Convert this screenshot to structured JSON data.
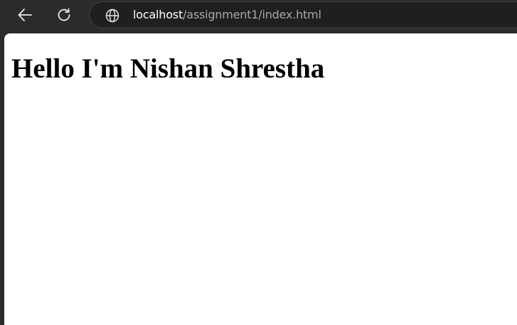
{
  "address_bar": {
    "url_host": "localhost",
    "url_path": "/assignment1/index.html"
  },
  "toolbar": {
    "back_icon": "arrow-left-icon",
    "reload_icon": "reload-icon",
    "site_info_icon": "globe-icon"
  },
  "page": {
    "heading": "Hello I'm Nishan Shrestha"
  },
  "colors": {
    "chrome_background": "#2b2b2b",
    "address_bar_background": "#1f1f1f",
    "url_host": "#ffffff",
    "url_path": "#a8a8a8",
    "page_background": "#ffffff",
    "heading_text": "#000000"
  }
}
